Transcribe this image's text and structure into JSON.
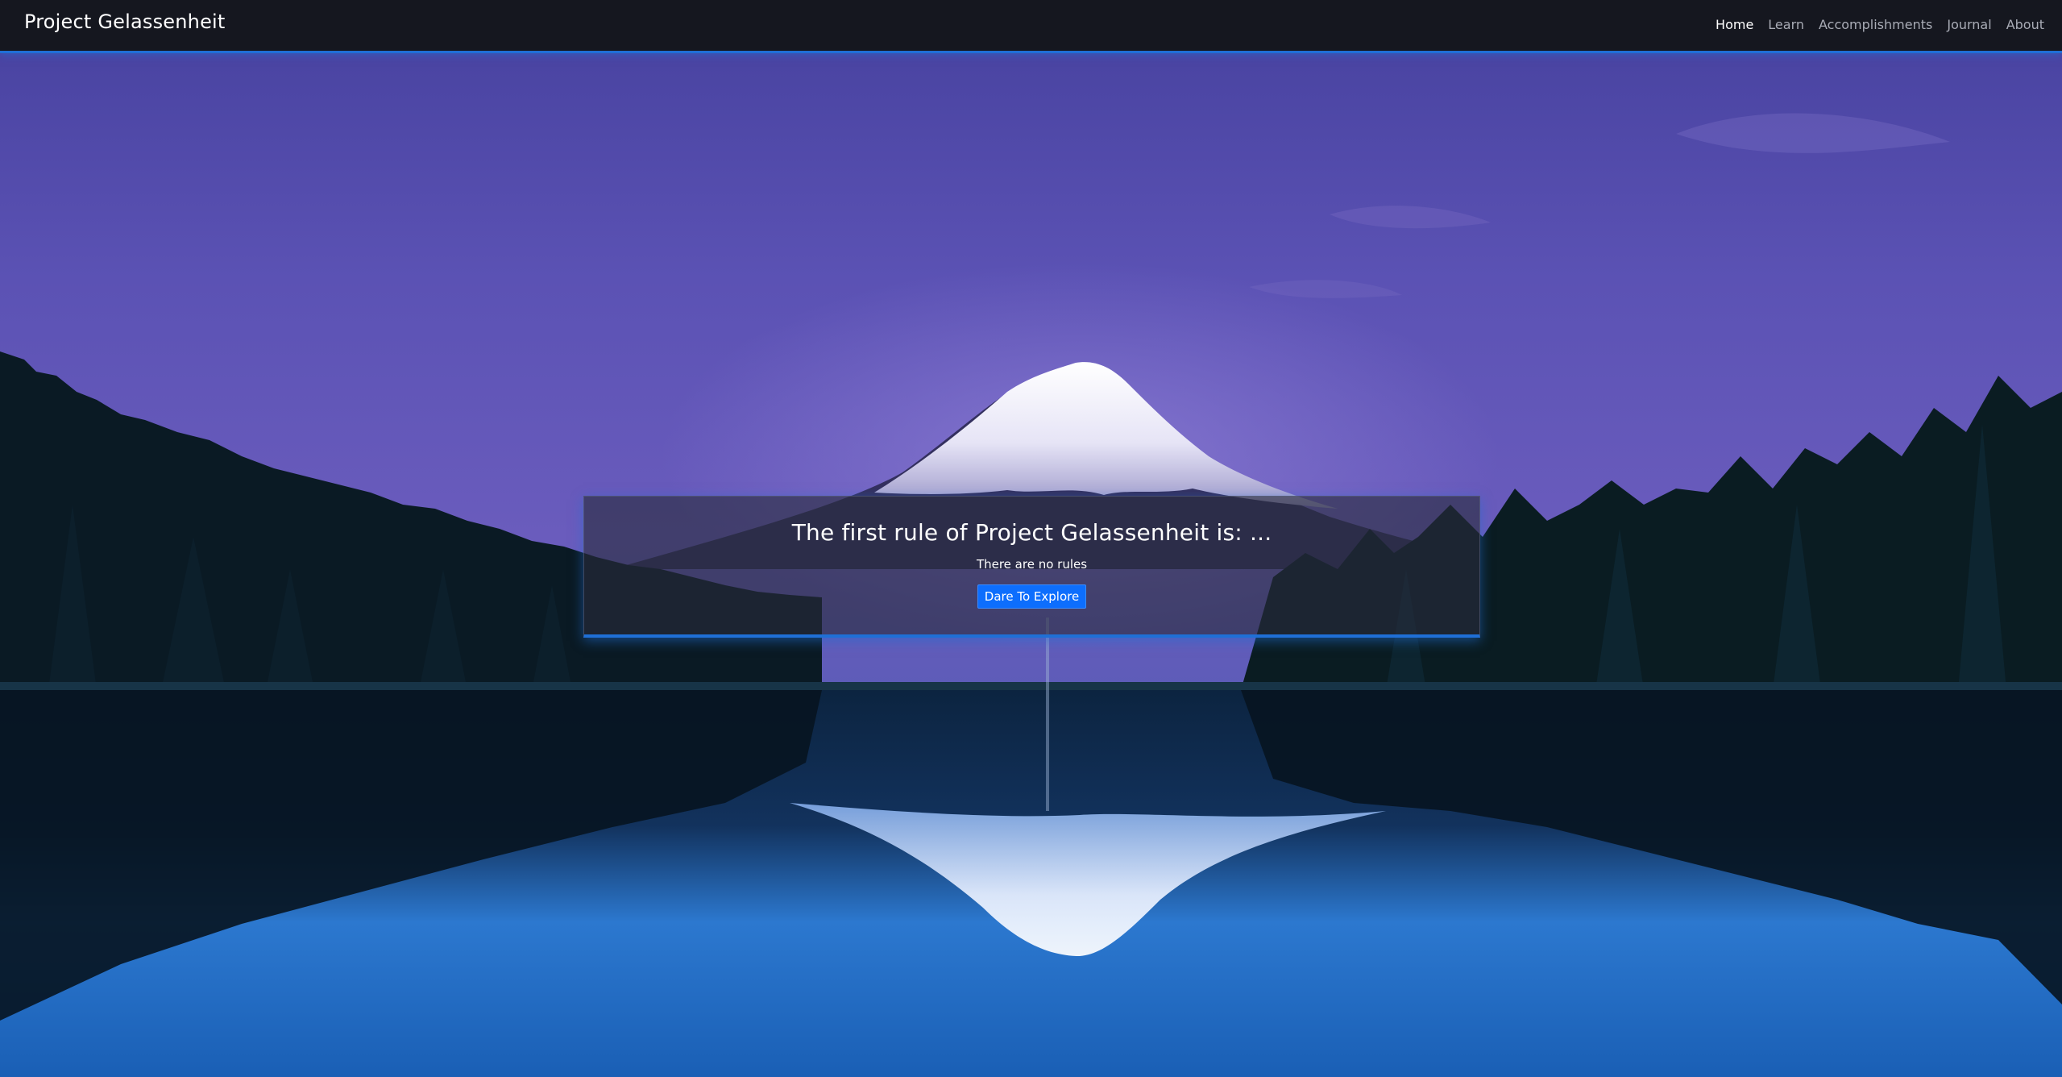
{
  "navbar": {
    "brand": "Project Gelassenheit",
    "links": [
      {
        "label": "Home",
        "active": true
      },
      {
        "label": "Learn",
        "active": false
      },
      {
        "label": "Accomplishments",
        "active": false
      },
      {
        "label": "Journal",
        "active": false
      },
      {
        "label": "About",
        "active": false
      }
    ]
  },
  "hero": {
    "background_icon": "mountain-lake-landscape",
    "colors": {
      "sky_top": "#5a4fae",
      "sky_horizon": "#6f5fc0",
      "water": "#2f7fd8",
      "accent": "#1f6fd6",
      "button": "#0d6efd"
    }
  },
  "card": {
    "title": "The first rule of Project Gelassenheit is: ...",
    "subtitle": "There are no rules",
    "button_label": "Dare To Explore"
  }
}
